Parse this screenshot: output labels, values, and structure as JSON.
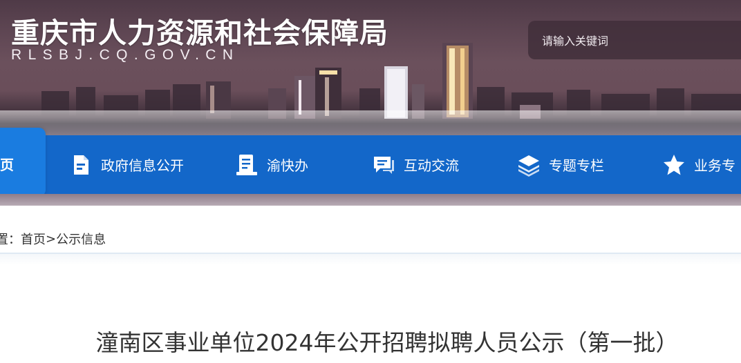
{
  "header": {
    "site_title": "重庆市人力资源和社会保障局",
    "site_domain": "RLSBJ.CQ.GOV.CN",
    "search_placeholder": "请输入关键词"
  },
  "nav": {
    "home_label": "页",
    "items": [
      {
        "label": "政府信息公开",
        "icon": "document-icon"
      },
      {
        "label": "渝快办",
        "icon": "form-icon"
      },
      {
        "label": "互动交流",
        "icon": "chat-icon"
      },
      {
        "label": "专题专栏",
        "icon": "layers-icon"
      },
      {
        "label": "业务专",
        "icon": "star-icon"
      }
    ]
  },
  "breadcrumb": {
    "prefix": "置：",
    "home": "首页",
    "separator": ">",
    "current": "公示信息"
  },
  "article": {
    "title": "潼南区事业单位2024年公开招聘拟聘人员公示（第一批）"
  },
  "colors": {
    "nav_bg": "#1367c9",
    "nav_home_bg": "#1a7ce0",
    "text": "#333333"
  }
}
